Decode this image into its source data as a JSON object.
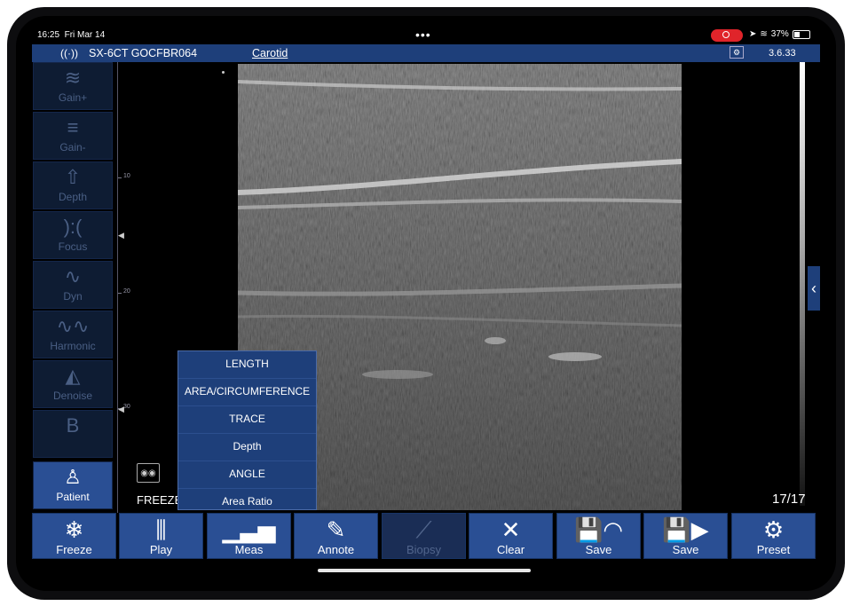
{
  "status": {
    "time": "16:25",
    "date": "Fri Mar 14",
    "dots": "•••",
    "battery": "37%",
    "location_icon": "location-arrow",
    "wifi_icon": "wifi"
  },
  "topbar": {
    "connection_icon": "antenna",
    "probe": "SX-6CT GOCFBR064",
    "preset_name": "Carotid",
    "probe_icon": "probe-settings",
    "version": "3.6.33"
  },
  "sidebar": {
    "items": [
      {
        "label": "Gain+",
        "icon": "gain-plus"
      },
      {
        "label": "Gain-",
        "icon": "gain-minus"
      },
      {
        "label": "Depth",
        "icon": "depth-arrow"
      },
      {
        "label": "Focus",
        "icon": "focus"
      },
      {
        "label": "Dyn",
        "icon": "dynamic-range"
      },
      {
        "label": "Harmonic",
        "icon": "harmonic-wave"
      },
      {
        "label": "Denoise",
        "icon": "denoise-fan"
      },
      {
        "label": "B",
        "icon": "b-mode"
      },
      {
        "label": "Patient",
        "icon": "patient"
      }
    ]
  },
  "scale": {
    "ticks": [
      "10",
      "20",
      "30"
    ]
  },
  "image": {
    "freeze_label": "FREEZE",
    "frame_counter": "17/17"
  },
  "measure_menu": {
    "items": [
      "LENGTH",
      "AREA/CIRCUMFERENCE",
      "TRACE",
      "Depth",
      "ANGLE",
      "Area Ratio"
    ]
  },
  "toolbar": {
    "buttons": [
      {
        "label": "Freeze",
        "icon": "snowflake"
      },
      {
        "label": "Play",
        "icon": "play-bars"
      },
      {
        "label": "Meas",
        "icon": "ruler"
      },
      {
        "label": "Annote",
        "icon": "annotate"
      },
      {
        "label": "Biopsy",
        "icon": "biopsy"
      },
      {
        "label": "Clear",
        "icon": "clear-x"
      },
      {
        "label": "Save",
        "icon": "save-image"
      },
      {
        "label": "Save",
        "icon": "save-video"
      },
      {
        "label": "Preset",
        "icon": "gear"
      }
    ]
  },
  "colors": {
    "accent": "#2a4f94",
    "topbar": "#1e3f7a",
    "disabled": "#1a2d55",
    "sidebar_dim": "#0e1c33",
    "record": "#e0242a"
  }
}
